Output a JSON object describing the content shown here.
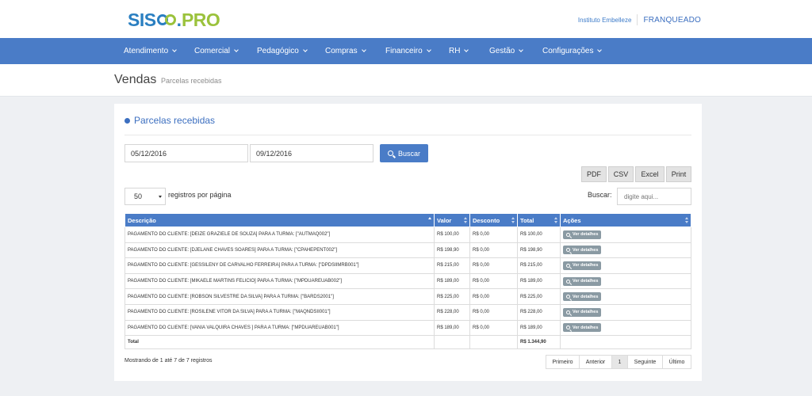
{
  "header": {
    "logo": {
      "part1": "SIS",
      "part2": ".",
      "part3": "PRO"
    },
    "institution_link": "Instituto Embelleze",
    "role": "FRANQUEADO"
  },
  "nav": [
    {
      "label": "Atendimento"
    },
    {
      "label": "Comercial"
    },
    {
      "label": "Pedagógico"
    },
    {
      "label": "Compras"
    },
    {
      "label": "Financeiro"
    },
    {
      "label": "RH"
    },
    {
      "label": "Gestão"
    },
    {
      "label": "Configurações"
    }
  ],
  "breadcrumb": {
    "title": "Vendas",
    "separator": "›",
    "current": "Parcelas recebidas"
  },
  "panel": {
    "title": "Parcelas recebidas",
    "date_from": "05/12/2016",
    "date_to": "09/12/2016",
    "search_button": "Buscar",
    "export": {
      "pdf": "PDF",
      "csv": "CSV",
      "excel": "Excel",
      "print": "Print"
    },
    "per_page_value": "50",
    "per_page_label": "registros por página",
    "search_label": "Buscar:",
    "search_placeholder": "digite aqui..."
  },
  "table": {
    "columns": {
      "descricao": "Descrição",
      "valor": "Valor",
      "desconto": "Desconto",
      "total": "Total",
      "acoes": "Ações"
    },
    "action_label": "Ver detalhes",
    "rows": [
      {
        "descricao": "PAGAMENTO DO CLIENTE: [DEIZE GRAZIELE DE SOUZA] PARA A TURMA: [\"AUTMAQ002\"]",
        "valor": "R$ 100,00",
        "desconto": "R$ 0,00",
        "total": "R$ 100,00"
      },
      {
        "descricao": "PAGAMENTO DO CLIENTE: [DJELANE CHAVES SOARES] PARA A TURMA: [\"CPAHEPENT002\"]",
        "valor": "R$ 198,90",
        "desconto": "R$ 0,00",
        "total": "R$ 198,90"
      },
      {
        "descricao": "PAGAMENTO DO CLIENTE: [GESSILENY DE CARVALHO FERREIRA] PARA A TURMA: [\"DPDSIIMRB001\"]",
        "valor": "R$ 215,00",
        "desconto": "R$ 0,00",
        "total": "R$ 215,00"
      },
      {
        "descricao": "PAGAMENTO DO CLIENTE: [MIKAELE MARTINS FELICIO] PARA A TURMA: [\"MPDUAREUAB002\"]",
        "valor": "R$ 189,00",
        "desconto": "R$ 0,00",
        "total": "R$ 189,00"
      },
      {
        "descricao": "PAGAMENTO DO CLIENTE: [ROBSON SILVESTRE DA SILVA] PARA A TURMA: [\"BARDS2001\"]",
        "valor": "R$ 225,00",
        "desconto": "R$ 0,00",
        "total": "R$ 225,00"
      },
      {
        "descricao": "PAGAMENTO DO CLIENTE: [ROSILENE VITOR DA SILVA] PARA A TURMA: [\"MAQNDSII001\"]",
        "valor": "R$ 228,00",
        "desconto": "R$ 0,00",
        "total": "R$ 228,00"
      },
      {
        "descricao": "PAGAMENTO DO CLIENTE: [VANIA VALQUIRA CHAVES ] PARA A TURMA: [\"MPDUAREUAB001\"]",
        "valor": "R$ 189,00",
        "desconto": "R$ 0,00",
        "total": "R$ 189,00"
      }
    ],
    "footer": {
      "label": "Total",
      "total": "R$ 1.344,90"
    }
  },
  "pagination": {
    "info": "Mostrando de 1 até 7 de 7 registros",
    "first": "Primeiro",
    "prev": "Anterior",
    "page": "1",
    "next": "Seguinte",
    "last": "Último"
  }
}
